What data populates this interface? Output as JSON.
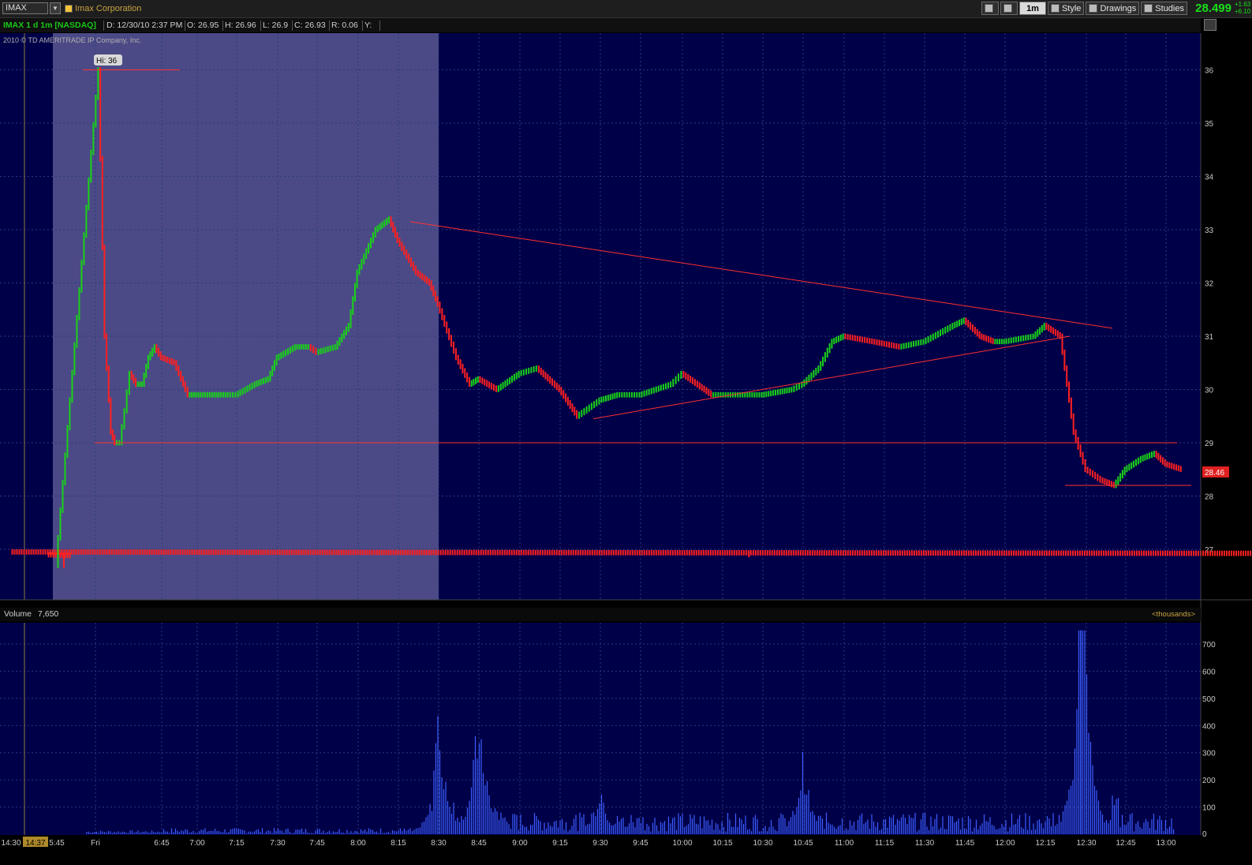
{
  "toolbar": {
    "symbol": "IMAX",
    "company": "Imax Corporation",
    "timeframe": "1m",
    "style_label": "Style",
    "drawings_label": "Drawings",
    "studies_label": "Studies",
    "last_price": "28.499",
    "change_1": "+1.63",
    "change_2": "+6.10"
  },
  "infobar": {
    "title": "IMAX 1 d 1m [NASDAQ]",
    "date": "D: 12/30/10 2:37 PM",
    "open": "O: 26.95",
    "high": "H: 26.96",
    "low": "L: 26.9",
    "close": "C: 26.93",
    "range": "R: 0.06",
    "y": "Y:"
  },
  "copyright": "2010 © TD AMERITRADE IP Company, Inc.",
  "volume_panel": {
    "label": "Volume",
    "value": "7,650",
    "units": "<thousands>"
  },
  "colors": {
    "background": "#000048",
    "premarket": "#4b4a86",
    "up": "#19d219",
    "down": "#ff2020",
    "trendline": "#ff3030",
    "volume": "#3d5fff"
  },
  "chart_data": [
    {
      "type": "line",
      "title": "IMAX 1 d 1m [NASDAQ]",
      "xlabel": "",
      "ylabel": "",
      "ylim": [
        26.0,
        37.0
      ],
      "y_ticks": [
        27,
        28,
        29,
        30,
        31,
        32,
        33,
        34,
        35,
        36
      ],
      "x_tick_labels": [
        "14:30",
        "14:37",
        "5:45",
        "Fri",
        "6:45",
        "7:00",
        "7:15",
        "7:30",
        "7:45",
        "8:00",
        "8:15",
        "8:30",
        "8:45",
        "9:00",
        "9:15",
        "9:30",
        "9:45",
        "10:00",
        "10:15",
        "10:30",
        "10:45",
        "11:00",
        "11:15",
        "11:30",
        "11:45",
        "12:00",
        "12:15",
        "12:30",
        "12:45",
        "13:00"
      ],
      "premarket_shading": [
        "5:45",
        "8:30"
      ],
      "annotation": "Hi: 36",
      "last_price_label": "28.46",
      "series": [
        {
          "x": [
            "14:30",
            "14:45",
            "15:00",
            "15:15",
            "5:45",
            "5:55",
            "6:00",
            "6:05",
            "6:08",
            "6:12",
            "6:16",
            "6:20",
            "6:25",
            "6:30",
            "6:35",
            "6:40",
            "6:45",
            "6:50",
            "6:55",
            "7:00",
            "7:05",
            "7:10",
            "7:15",
            "7:20",
            "7:25",
            "7:30",
            "7:35",
            "7:40",
            "7:45",
            "7:50",
            "7:55",
            "8:00",
            "8:05",
            "8:10",
            "8:15",
            "8:20",
            "8:25",
            "8:30",
            "8:35",
            "8:40",
            "8:45",
            "8:50",
            "9:00",
            "9:05",
            "9:15",
            "9:20",
            "9:30",
            "9:35",
            "9:45",
            "9:55",
            "10:00",
            "10:10",
            "10:20",
            "10:30",
            "10:40",
            "10:45",
            "10:50",
            "10:55",
            "11:00",
            "11:10",
            "11:20",
            "11:30",
            "11:40",
            "11:45",
            "11:50",
            "11:55",
            "12:00",
            "12:10",
            "12:15",
            "12:20",
            "12:25",
            "12:30",
            "12:35",
            "12:40",
            "12:45",
            "12:50",
            "12:55",
            "13:00",
            "13:05"
          ],
          "values": [
            26.95,
            26.92,
            26.9,
            26.88,
            26.7,
            36.0,
            31.0,
            29.2,
            29.0,
            29.0,
            29.6,
            30.3,
            30.1,
            30.1,
            30.6,
            30.8,
            30.6,
            30.5,
            29.9,
            29.9,
            29.9,
            29.9,
            29.9,
            30.1,
            30.2,
            30.6,
            30.8,
            30.8,
            30.7,
            30.8,
            31.2,
            32.2,
            33.0,
            33.2,
            32.8,
            32.2,
            32.0,
            31.6,
            30.6,
            30.1,
            30.2,
            30.0,
            30.3,
            30.4,
            30.0,
            29.5,
            29.8,
            29.9,
            29.9,
            30.1,
            30.3,
            29.9,
            29.9,
            29.9,
            30.0,
            30.1,
            30.4,
            30.9,
            31.0,
            30.9,
            30.8,
            30.9,
            31.2,
            31.3,
            31.0,
            30.9,
            30.9,
            31.0,
            31.2,
            31.0,
            29.2,
            28.5,
            28.3,
            28.2,
            28.5,
            28.7,
            28.8,
            28.6,
            28.5
          ]
        }
      ],
      "horizontal_lines": [
        29.0,
        28.2
      ]
    },
    {
      "type": "bar",
      "title": "Volume",
      "ylabel": "",
      "ylim": [
        0,
        750
      ],
      "y_ticks": [
        100,
        200,
        300,
        400,
        500,
        600,
        700
      ],
      "y_tick_labels": [
        "100",
        "200",
        "300",
        "400",
        "500",
        "600",
        "700"
      ],
      "peak_values": {
        "8:30": 320,
        "8:45": 330,
        "9:30": 200,
        "10:45": 300,
        "12:27": 750,
        "12:30": 345
      }
    }
  ]
}
